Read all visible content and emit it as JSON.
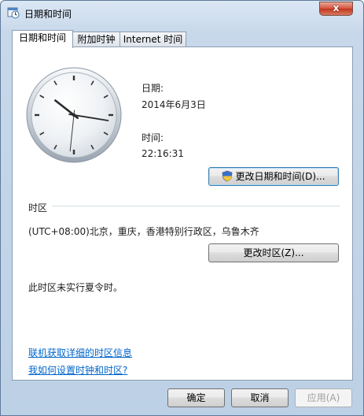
{
  "window": {
    "title": "日期和时间",
    "close_glyph": "x"
  },
  "tabs": [
    {
      "label": "日期和时间"
    },
    {
      "label": "附加时钟"
    },
    {
      "label": "Internet 时间"
    }
  ],
  "clock": {
    "hour": 22,
    "minute": 16,
    "second": 31
  },
  "date": {
    "label": "日期:",
    "value": "2014年6月3日"
  },
  "time": {
    "label": "时间:",
    "value": "22:16:31"
  },
  "change_datetime_button": {
    "label": "更改日期和时间(D)...",
    "icon": "uac-shield-icon"
  },
  "timezone": {
    "section_label": "时区",
    "value": "(UTC+08:00)北京，重庆，香港特别行政区，乌鲁木齐",
    "change_button": "更改时区(Z)...",
    "dst_note": "此时区未实行夏令时。"
  },
  "links": [
    {
      "text": "联机获取详细的时区信息"
    },
    {
      "text": "我如何设置时钟和时区?"
    }
  ],
  "footer": {
    "ok": "确定",
    "cancel": "取消",
    "apply": "应用(A)"
  }
}
